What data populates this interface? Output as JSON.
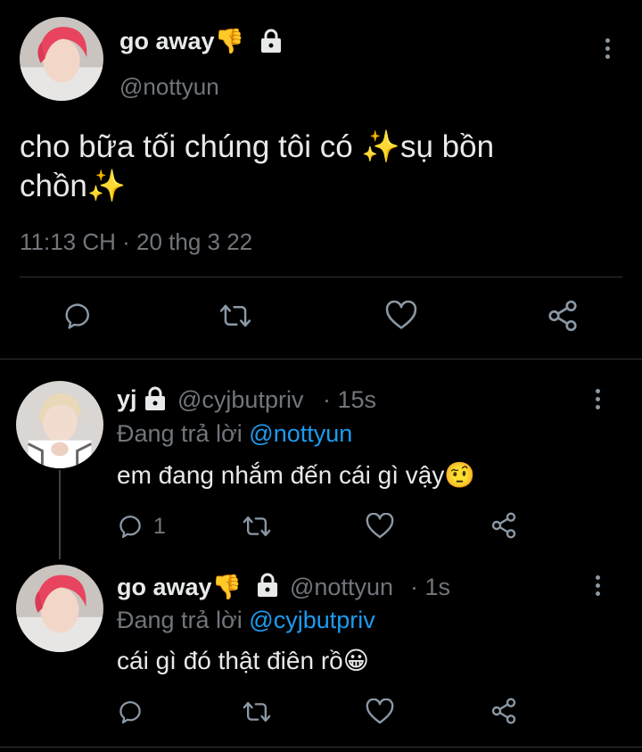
{
  "main_tweet": {
    "display_name": "go away👎",
    "handle": "@nottyun",
    "text_line1": "cho bữa tối chúng tôi có ✨sụ bồn",
    "text_line2": "chồn✨",
    "timestamp": "11:13 CH · 20 thg 3 22"
  },
  "replies": [
    {
      "display_name": "yj",
      "handle": "@cyjbutpriv",
      "time": "· 15s",
      "replying_to_label": "Đang trả lời",
      "replying_to_handle": "@nottyun",
      "text": "em đang nhắm đến cái gì vậy🤨",
      "reply_count": "1"
    },
    {
      "display_name": "go away👎",
      "handle": "@nottyun",
      "time": "· 1s",
      "replying_to_label": "Đang trả lời",
      "replying_to_handle": "@cyjbutpriv",
      "text": "cái gì đó thật điên rồ😀"
    }
  ],
  "colors": {
    "background": "#000000",
    "text": "#e7e9ea",
    "muted": "#71767b",
    "link": "#1d9bf0",
    "divider": "#2f3336"
  },
  "icons": [
    "reply-icon",
    "retweet-icon",
    "like-icon",
    "share-icon",
    "lock-icon",
    "more-icon"
  ]
}
